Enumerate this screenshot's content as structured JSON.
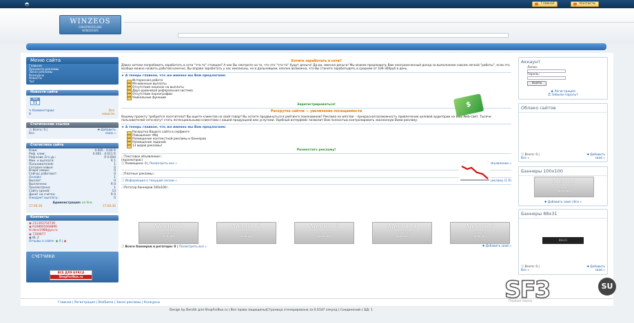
{
  "topbar": {
    "buttons": [
      "Главная",
      "Контакты"
    ]
  },
  "header": {
    "logo_title": "WINZEOS",
    "logo_subtitle_1": "ОФОРМЛЕНИЕ",
    "logo_subtitle_2": "WINDOWS"
  },
  "left": {
    "menu_title": "Меню сайта",
    "menu_items": [
      "Главная",
      "Просмотр рекламы",
      "Заказ рекламы",
      "Конкурсы",
      "Новости",
      "Чат"
    ],
    "news_title": "Новости сайта",
    "news_date_month": "Янв",
    "news_date_day": "01",
    "news_comments": "Комментарии:",
    "news_all": "Все",
    "news_all_2": "новости",
    "static_title": "Статические ссылки",
    "static_total": "Всего: 0 |",
    "static_add": "Добавить",
    "static_all": "Все",
    "static_own": "свою »",
    "stats_title": "Статистика сайта",
    "stats": [
      [
        "Клик:",
        "0.005 - 0.00 R"
      ],
      [
        "Реф. клик:",
        "0.001 - 0.011 R"
      ],
      [
        "Реф.клик 2го ур.:",
        "R 0.004"
      ],
      [
        "Мин. к выплате:",
        "R 1"
      ],
      [
        "Пользователей:",
        "1"
      ],
      [
        "Сегодня новых:",
        "0"
      ],
      [
        "Вчера новых:",
        "0"
      ],
      [
        "Сейчас работают:",
        "0"
      ],
      [
        "Онлайн:",
        "1"
      ],
      [
        "Выплат:",
        "0"
      ],
      [
        "Выплачено:",
        "R 0"
      ],
      [
        "Просмотрено:",
        "1"
      ],
      [
        "Сайту (дней):",
        "13"
      ],
      [
        "Денег на счетах:",
        "R 0"
      ],
      [
        "Ожидает выплату:",
        "0"
      ]
    ],
    "admin_label": "Администрация:",
    "admin_status": "on-line",
    "admin_time_left": "17:00:30",
    "admin_time_right": "17:00:30",
    "contacts_title": "Контакты",
    "contacts": [
      "211303754736",
      "R298665068890",
      "dens1988@ya.ru",
      "7300877",
      "BL",
      "2"
    ],
    "contacts_footer": "Отзывы о сайте:",
    "contacts_footer_count": "0 |",
    "counters_title": "СЧЕТЧИКИ",
    "counter_line_1": "ВСЕ ДЛЯ БУКСА",
    "counter_line_2": "ShopForBux.ru"
  },
  "main": {
    "earn_title": "Хотите заработать в сети?",
    "earn_text": "Давно хотели попробовать заработать в сети \"что-то\" стоящее? А как Вы смотрите на то, что это \"что-то\" будут деньги! Да-да, именно деньги! Мы можем предложить Вам неограниченный доход за выполнение совсем легкой \"работы\", если это вообще можно назвать работой конечно. Вы вправе заработать у нас миллионы, но в дальнейшем, вполне возможно, что Вы станете зарабатывать в среднем от 100-300руб в день.",
    "offer_title": "А теперь главное, что же именно мы Вам предлагаем:",
    "features": [
      "Интересная работа",
      "Мгновенные выплаты",
      "Отсутствие наценок на выплаты",
      "Двух-уровневая реферальная система",
      "Отсутствие порнографии",
      "Уникальные функции"
    ],
    "register_link": "Зарегистрироваться!",
    "promo_title": "Раскрутка сайтов — увеличение посещаемости",
    "promo_text": "Вашему проекту требуются посетители? Вы ищете клиентов на свой товар? Вы хотите продвинуться в рейтинге поисковиков? Реклама на wmr-bar - прекрасная возможность привлечения целевой аудитории на Ваш Web-сайт. Тысячи пользователей сети могут стать потенциальными клиентами с вашей продукцией или услугами. Удобный интерфейс позволит Вам полностью контролировать заказанную Вами рекламу.",
    "offer2_title": "А теперь главное, что же именно мы Вам предлагаем:",
    "features2": [
      "Раскрутка Вашего сайта в серфинге",
      "Повышение тИЦ",
      "Размещение контекстной рекламы и баннеров",
      "Размещение заданий",
      "13 видов рекламы!"
    ],
    "place_link": "Разместить рекламу!",
    "text_ad_label": ".::Текстовое объявление::.",
    "text_ad_sub": "(просмотров:)",
    "text_ad_count": "Размещено: 0 |",
    "text_ad_view": "Посмотреть все »",
    "text_ad_place": "Разместить своё объявление »",
    "paid_label": ".::Платные рекламы::.",
    "paid_info": "Информация о текущей сессии »",
    "paid_order": "Заказать рекламу (1 R)",
    "rotator_label": ".::Ротатор баннеров 100x100::.",
    "banners": [
      "Место 1",
      "Место 2",
      "Место 3",
      "Место 4",
      "Место 5"
    ],
    "banner_sub_1": "100x100",
    "banner_sub_2": "свободно",
    "banners_total": "Всего баннеров в ротаторе: 0 |",
    "banners_view": "Посмотреть все »",
    "banners_add": "Добавить свой »"
  },
  "right": {
    "account_title": "Аккаунт",
    "login_label": "Логин:",
    "password_label": "Пароль:",
    "login_button": "Войти",
    "register_link": "Регистрация",
    "forgot_link": "Забыли пароль?",
    "cloud_title": "Облако сайтов",
    "cloud_total": "Всего: 0 |",
    "cloud_add": "Добавить",
    "cloud_all": "Все »",
    "cloud_own": "свой »",
    "b100_title": "Баннеры 100x100",
    "b100_banner": "Место",
    "b100_banner_sub_1": "100x100",
    "b100_banner_sub_2": "свободно",
    "b100_add": "Добавить свой | Все »",
    "b88_title": "Баннеры 88x31",
    "b88_banner": "88x31",
    "b88_total": "Всего: 0 |",
    "b88_add": "Добавить",
    "b88_all": "Все »",
    "b88_own": "свой »"
  },
  "footer": {
    "links": "Главная | Регистрация | StatSama | Заказ рекламы | Конкурсы",
    "copyright": "Design by Den4ik для ShopForBux.ru | Все права защищены|Страница сгенерирована за 0.0147 секунд | Соединений с БД: 1",
    "right_text": "Первый перед",
    "watermark": "SF3",
    "watermark_badge": "SU"
  }
}
